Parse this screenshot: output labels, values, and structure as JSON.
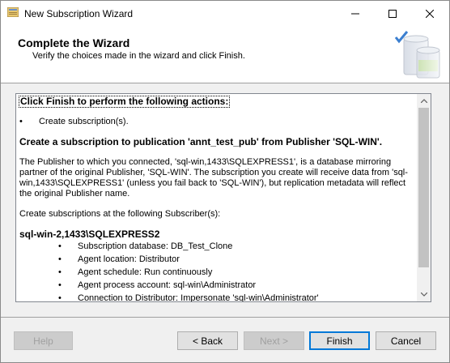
{
  "window": {
    "title": "New Subscription Wizard"
  },
  "header": {
    "title": "Complete the Wizard",
    "subtitle": "Verify the choices made in the wizard and click Finish."
  },
  "content": {
    "intro": "Click Finish to perform the following actions:",
    "bullet1": "Create subscription(s).",
    "section_heading": "Create a subscription to publication 'annt_test_pub' from Publisher 'SQL-WIN'.",
    "paragraph": "The Publisher to which you connected, 'sql-win,1433\\SQLEXPRESS1', is a database mirroring partner of the original Publisher, 'SQL-WIN'. The subscription you create will receive data from 'sql-win,1433\\SQLEXPRESS1' (unless you fail back to 'SQL-WIN'), but replication metadata will reflect the original Publisher name.",
    "subscribers_label": "Create subscriptions at the following Subscriber(s):",
    "subscriber_name": "sql-win-2,1433\\SQLEXPRESS2",
    "details": [
      "Subscription database: DB_Test_Clone",
      "Agent location: Distributor",
      "Agent schedule: Run continuously",
      "Agent process account: sql-win\\Administrator",
      "Connection to Distributor: Impersonate 'sql-win\\Administrator'"
    ]
  },
  "buttons": {
    "help": "Help",
    "back": "< Back",
    "next": "Next >",
    "finish": "Finish",
    "cancel": "Cancel"
  }
}
